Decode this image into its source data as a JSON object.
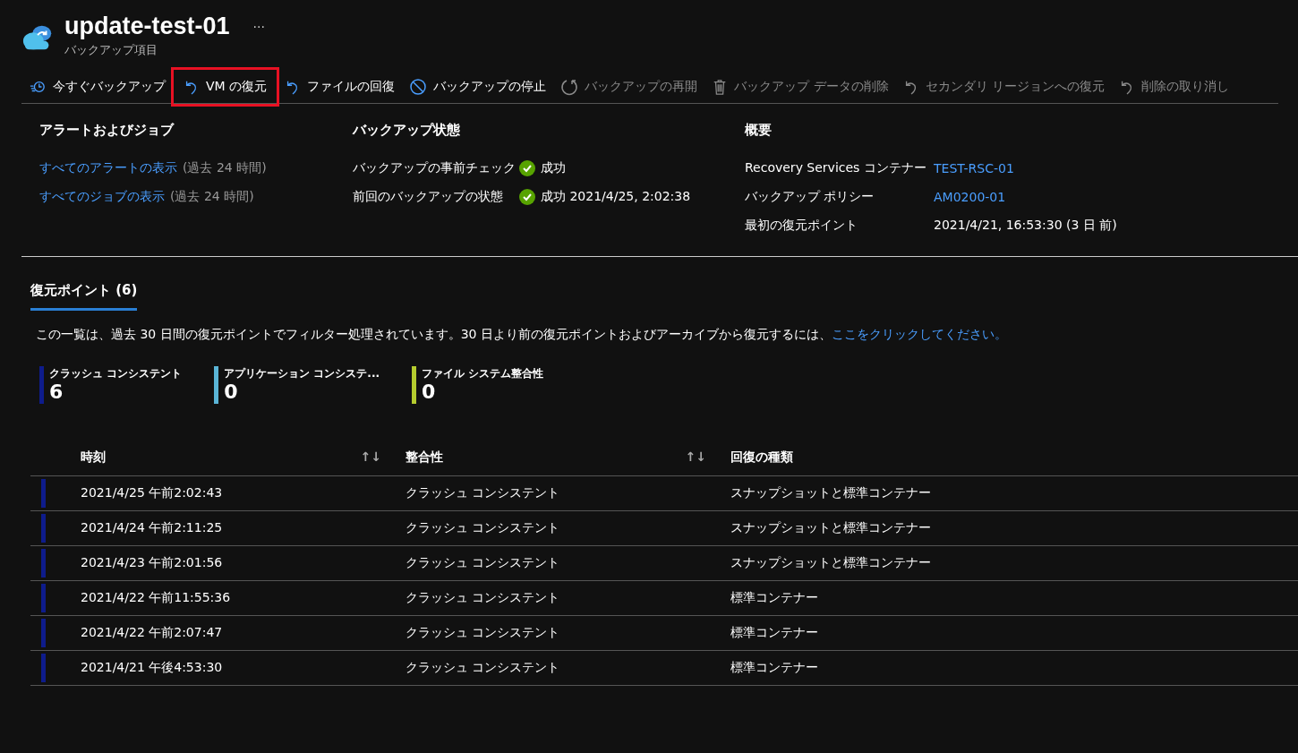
{
  "header": {
    "title": "update-test-01",
    "more": "···",
    "subtitle": "バックアップ項目"
  },
  "toolbar": [
    {
      "label": "今すぐバックアップ",
      "kind": "backup",
      "disabled": false,
      "highlighted": false
    },
    {
      "label": "VM の復元",
      "kind": "undo",
      "disabled": false,
      "highlighted": true
    },
    {
      "label": "ファイルの回復",
      "kind": "undo",
      "disabled": false,
      "highlighted": false
    },
    {
      "label": "バックアップの停止",
      "kind": "stop",
      "disabled": false,
      "highlighted": false
    },
    {
      "label": "バックアップの再開",
      "kind": "refresh",
      "disabled": true,
      "highlighted": false
    },
    {
      "label": "バックアップ データの削除",
      "kind": "trash",
      "disabled": true,
      "highlighted": false
    },
    {
      "label": "セカンダリ リージョンへの復元",
      "kind": "undo",
      "disabled": true,
      "highlighted": false
    },
    {
      "label": "削除の取り消し",
      "kind": "undo",
      "disabled": true,
      "highlighted": false
    }
  ],
  "alerts": {
    "title": "アラートおよびジョブ",
    "links": [
      {
        "label": "すべてのアラートの表示",
        "note": "(過去 24 時間)"
      },
      {
        "label": "すべてのジョブの表示",
        "note": "(過去 24 時間)"
      }
    ]
  },
  "backup_status": {
    "title": "バックアップ状態",
    "rows": [
      {
        "label": "バックアップの事前チェック",
        "value": "成功",
        "kind": "success"
      },
      {
        "label": "前回のバックアップの状態",
        "value": "成功 2021/4/25, 2:02:38",
        "kind": "success"
      }
    ]
  },
  "summary": {
    "title": "概要",
    "rows": [
      {
        "label": "Recovery Services コンテナー",
        "value": "TEST-RSC-01",
        "link": true
      },
      {
        "label": "バックアップ ポリシー",
        "value": "AM0200-01",
        "link": true
      },
      {
        "label": "最初の復元ポイント",
        "value": "2021/4/21, 16:53:30 (3 日 前)",
        "link": false
      }
    ]
  },
  "tabs": [
    {
      "label": "復元ポイント (6)",
      "selected": true
    }
  ],
  "info": {
    "text": "この一覧は、過去 30 日間の復元ポイントでフィルター処理されています。30 日より前の復元ポイントおよびアーカイブから復元するには、",
    "link": "ここをクリックしてください。"
  },
  "counts": [
    {
      "label": "クラッシュ コンシステント",
      "value": "6",
      "color": "#0e1c8c"
    },
    {
      "label": "アプリケーション コンシステ...",
      "value": "0",
      "color": "#5ab4d6"
    },
    {
      "label": "ファイル システム整合性",
      "value": "0",
      "color": "#b5cc2e"
    }
  ],
  "table": {
    "columns": [
      {
        "label": "時刻",
        "sort": "↑↓"
      },
      {
        "label": "整合性",
        "sort": "↑↓"
      },
      {
        "label": "回復の種類"
      }
    ],
    "rows": [
      {
        "cells": [
          "2021/4/25 午前2:02:43",
          "クラッシュ コンシステント",
          "スナップショットと標準コンテナー"
        ],
        "color": "#0e1c8c"
      },
      {
        "cells": [
          "2021/4/24 午前2:11:25",
          "クラッシュ コンシステント",
          "スナップショットと標準コンテナー"
        ],
        "color": "#0e1c8c"
      },
      {
        "cells": [
          "2021/4/23 午前2:01:56",
          "クラッシュ コンシステント",
          "スナップショットと標準コンテナー"
        ],
        "color": "#0e1c8c"
      },
      {
        "cells": [
          "2021/4/22 午前11:55:36",
          "クラッシュ コンシステント",
          "標準コンテナー"
        ],
        "color": "#0e1c8c"
      },
      {
        "cells": [
          "2021/4/22 午前2:07:47",
          "クラッシュ コンシステント",
          "標準コンテナー"
        ],
        "color": "#0e1c8c"
      },
      {
        "cells": [
          "2021/4/21 午後4:53:30",
          "クラッシュ コンシステント",
          "標準コンテナー"
        ],
        "color": "#0e1c8c"
      }
    ]
  }
}
